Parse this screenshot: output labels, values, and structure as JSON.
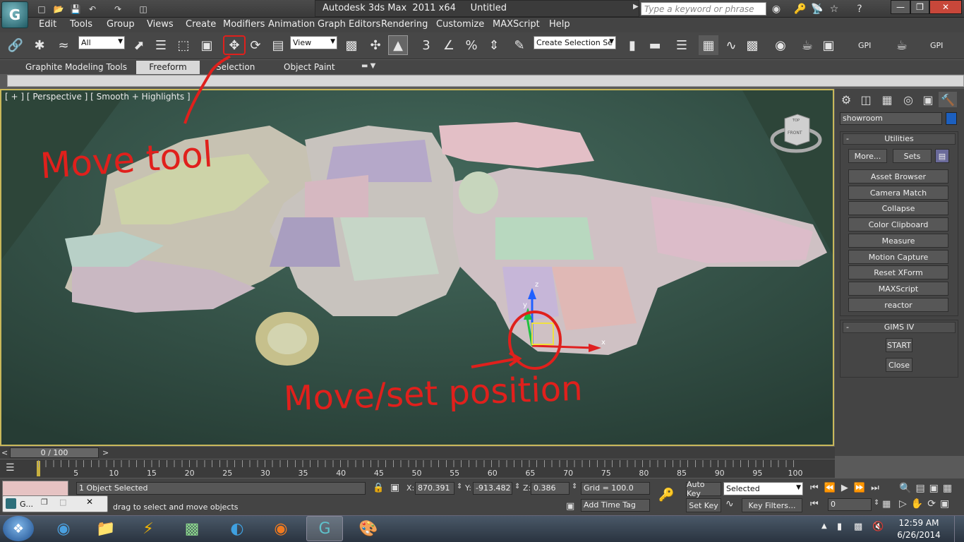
{
  "window": {
    "app_title": "Autodesk 3ds Max  2011 x64",
    "doc_title": "Untitled",
    "search_placeholder": "Type a keyword or phrase",
    "logo_glyph": "G"
  },
  "menu": [
    "Edit",
    "Tools",
    "Group",
    "Views",
    "Create",
    "Modifiers",
    "Animation",
    "Graph Editors",
    "Rendering",
    "Customize",
    "MAXScript",
    "Help"
  ],
  "toolbar": {
    "selection_filter": "All",
    "ref_coord_system": "View",
    "named_selection": "Create Selection Se",
    "gpi_label_1": "GPI",
    "gpi_label_2": "GPI"
  },
  "ribbon": {
    "tabs": [
      "Graphite Modeling Tools",
      "Freeform",
      "Selection",
      "Object Paint"
    ],
    "active_tab": "Freeform"
  },
  "viewport": {
    "label": "[ + ] [ Perspective ] [ Smooth + Highlights ]",
    "viewcube_top": "TOP",
    "viewcube_front": "FRONT",
    "gizmo_z": "z",
    "gizmo_y": "y",
    "gizmo_x": "x"
  },
  "command_panel": {
    "object_name": "showroom",
    "object_color": "#1c5fbf",
    "utilities_title": "Utilities",
    "more_button": "More...",
    "sets_button": "Sets",
    "utilities": [
      "Asset Browser",
      "Camera Match",
      "Collapse",
      "Color Clipboard",
      "Measure",
      "Motion Capture",
      "Reset XForm",
      "MAXScript",
      "reactor"
    ],
    "gims_title": "GIMS IV",
    "start_button": "START",
    "close_button": "Close"
  },
  "timeline": {
    "frame_counter": "0 / 100",
    "ticks": [
      "5",
      "10",
      "15",
      "20",
      "25",
      "30",
      "35",
      "40",
      "45",
      "50",
      "55",
      "60",
      "65",
      "70",
      "75",
      "80",
      "85",
      "90",
      "95",
      "100"
    ]
  },
  "status": {
    "selection_info": "1 Object Selected",
    "prompt": "drag to select and move objects",
    "x_label": "X:",
    "x_value": "870.391",
    "y_label": "Y:",
    "y_value": "-913.482",
    "z_label": "Z:",
    "z_value": "0.386",
    "grid": "Grid = 100.0",
    "add_time_tag": "Add Time Tag",
    "auto_key": "Auto Key",
    "set_key": "Set Key",
    "key_mode": "Selected",
    "key_filters": "Key Filters...",
    "current_frame": "0",
    "mini_window_label": "G..."
  },
  "taskbar": {
    "time": "12:59 AM",
    "date": "6/26/2014"
  },
  "annotations": {
    "move_tool": "Move tool",
    "move_set_position": "Move/set position"
  }
}
